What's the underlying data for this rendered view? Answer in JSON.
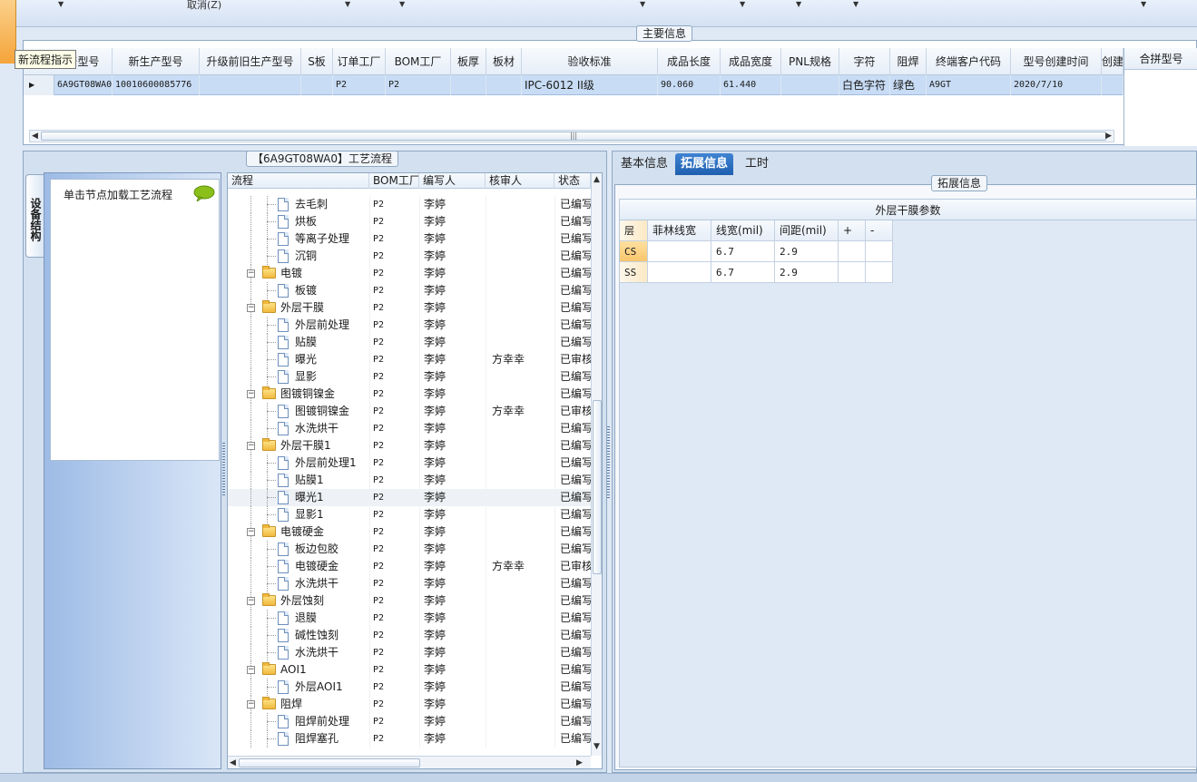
{
  "toolbar": {
    "cancel_label": "取消(Z)"
  },
  "tooltip": "新流程指示",
  "main_info": {
    "group_title": "主要信息",
    "columns": [
      "产型号",
      "新生产型号",
      "升级前旧生产型号",
      "S板",
      "订单工厂",
      "BOM工厂",
      "板厚",
      "板材",
      "验收标准",
      "成品长度",
      "成品宽度",
      "PNL规格",
      "字符",
      "阻焊",
      "终端客户代码",
      "型号创建时间",
      "创建人"
    ],
    "merge_column": "合拼型号",
    "row": [
      "6A9GT08WA0",
      "10010600085776",
      "",
      "",
      "P2",
      "P2",
      "",
      "",
      "IPC-6012 II级",
      "90.060",
      "61.440",
      "",
      "白色字符",
      "绿色",
      "A9GT",
      "2020/7/10",
      ""
    ]
  },
  "vertical_tab": "设备结构",
  "left_panel": {
    "hint": "单击节点加载工艺流程"
  },
  "flow": {
    "group_title": "【6A9GT08WA0】工艺流程",
    "columns": [
      "流程",
      "BOM工厂",
      "编写人",
      "核审人",
      "状态"
    ],
    "rows": [
      {
        "level": 2,
        "type": "doc",
        "name": "去毛刺",
        "bom": "P2",
        "author": "李婷",
        "reviewer": "",
        "status": "已编写"
      },
      {
        "level": 2,
        "type": "doc",
        "name": "烘板",
        "bom": "P2",
        "author": "李婷",
        "reviewer": "",
        "status": "已编写"
      },
      {
        "level": 2,
        "type": "doc",
        "name": "等离子处理",
        "bom": "P2",
        "author": "李婷",
        "reviewer": "",
        "status": "已编写"
      },
      {
        "level": 2,
        "type": "doc",
        "name": "沉铜",
        "bom": "P2",
        "author": "李婷",
        "reviewer": "",
        "status": "已编写"
      },
      {
        "level": 1,
        "type": "folder",
        "name": "电镀",
        "bom": "P2",
        "author": "李婷",
        "reviewer": "",
        "status": "已编写"
      },
      {
        "level": 2,
        "type": "doc",
        "name": "板镀",
        "bom": "P2",
        "author": "李婷",
        "reviewer": "",
        "status": "已编写"
      },
      {
        "level": 1,
        "type": "folder",
        "name": "外层干膜",
        "bom": "P2",
        "author": "李婷",
        "reviewer": "",
        "status": "已编写"
      },
      {
        "level": 2,
        "type": "doc",
        "name": "外层前处理",
        "bom": "P2",
        "author": "李婷",
        "reviewer": "",
        "status": "已编写"
      },
      {
        "level": 2,
        "type": "doc",
        "name": "贴膜",
        "bom": "P2",
        "author": "李婷",
        "reviewer": "",
        "status": "已编写"
      },
      {
        "level": 2,
        "type": "doc",
        "name": "曝光",
        "bom": "P2",
        "author": "李婷",
        "reviewer": "方幸幸",
        "status": "已审核"
      },
      {
        "level": 2,
        "type": "doc",
        "name": "显影",
        "bom": "P2",
        "author": "李婷",
        "reviewer": "",
        "status": "已编写"
      },
      {
        "level": 1,
        "type": "folder",
        "name": "图镀铜镍金",
        "bom": "P2",
        "author": "李婷",
        "reviewer": "",
        "status": "已编写"
      },
      {
        "level": 2,
        "type": "doc",
        "name": "图镀铜镍金",
        "bom": "P2",
        "author": "李婷",
        "reviewer": "方幸幸",
        "status": "已审核"
      },
      {
        "level": 2,
        "type": "doc",
        "name": "水洗烘干",
        "bom": "P2",
        "author": "李婷",
        "reviewer": "",
        "status": "已编写"
      },
      {
        "level": 1,
        "type": "folder",
        "name": "外层干膜1",
        "bom": "P2",
        "author": "李婷",
        "reviewer": "",
        "status": "已编写"
      },
      {
        "level": 2,
        "type": "doc",
        "name": "外层前处理1",
        "bom": "P2",
        "author": "李婷",
        "reviewer": "",
        "status": "已编写"
      },
      {
        "level": 2,
        "type": "doc",
        "name": "贴膜1",
        "bom": "P2",
        "author": "李婷",
        "reviewer": "",
        "status": "已编写"
      },
      {
        "level": 2,
        "type": "doc",
        "name": "曝光1",
        "bom": "P2",
        "author": "李婷",
        "reviewer": "",
        "status": "已编写",
        "selected": true
      },
      {
        "level": 2,
        "type": "doc",
        "name": "显影1",
        "bom": "P2",
        "author": "李婷",
        "reviewer": "",
        "status": "已编写"
      },
      {
        "level": 1,
        "type": "folder",
        "name": "电镀硬金",
        "bom": "P2",
        "author": "李婷",
        "reviewer": "",
        "status": "已编写"
      },
      {
        "level": 2,
        "type": "doc",
        "name": "板边包胶",
        "bom": "P2",
        "author": "李婷",
        "reviewer": "",
        "status": "已编写"
      },
      {
        "level": 2,
        "type": "doc",
        "name": "电镀硬金",
        "bom": "P2",
        "author": "李婷",
        "reviewer": "方幸幸",
        "status": "已审核"
      },
      {
        "level": 2,
        "type": "doc",
        "name": "水洗烘干",
        "bom": "P2",
        "author": "李婷",
        "reviewer": "",
        "status": "已编写"
      },
      {
        "level": 1,
        "type": "folder",
        "name": "外层蚀刻",
        "bom": "P2",
        "author": "李婷",
        "reviewer": "",
        "status": "已编写"
      },
      {
        "level": 2,
        "type": "doc",
        "name": "退膜",
        "bom": "P2",
        "author": "李婷",
        "reviewer": "",
        "status": "已编写"
      },
      {
        "level": 2,
        "type": "doc",
        "name": "碱性蚀刻",
        "bom": "P2",
        "author": "李婷",
        "reviewer": "",
        "status": "已编写"
      },
      {
        "level": 2,
        "type": "doc",
        "name": "水洗烘干",
        "bom": "P2",
        "author": "李婷",
        "reviewer": "",
        "status": "已编写"
      },
      {
        "level": 1,
        "type": "folder",
        "name": "AOI1",
        "bom": "P2",
        "author": "李婷",
        "reviewer": "",
        "status": "已编写"
      },
      {
        "level": 2,
        "type": "doc",
        "name": "外层AOI1",
        "bom": "P2",
        "author": "李婷",
        "reviewer": "",
        "status": "已编写"
      },
      {
        "level": 1,
        "type": "folder",
        "name": "阻焊",
        "bom": "P2",
        "author": "李婷",
        "reviewer": "",
        "status": "已编写"
      },
      {
        "level": 2,
        "type": "doc",
        "name": "阻焊前处理",
        "bom": "P2",
        "author": "李婷",
        "reviewer": "",
        "status": "已编写"
      },
      {
        "level": 2,
        "type": "doc",
        "name": "阻焊塞孔",
        "bom": "P2",
        "author": "李婷",
        "reviewer": "",
        "status": "已编写"
      }
    ]
  },
  "right_tabs": [
    {
      "label": "基本信息",
      "active": false
    },
    {
      "label": "拓展信息",
      "active": true
    },
    {
      "label": "工时",
      "active": false
    }
  ],
  "ext_info": {
    "group_title": "拓展信息",
    "table_title": "外层干膜参数",
    "columns": [
      "层",
      "菲林线宽",
      "线宽(mil)",
      "间距(mil)",
      "+",
      "-"
    ],
    "rows": [
      {
        "layer": "CS",
        "film_width": "",
        "line_width": "6.7",
        "spacing": "2.9"
      },
      {
        "layer": "SS",
        "film_width": "",
        "line_width": "6.7",
        "spacing": "2.9"
      }
    ]
  }
}
